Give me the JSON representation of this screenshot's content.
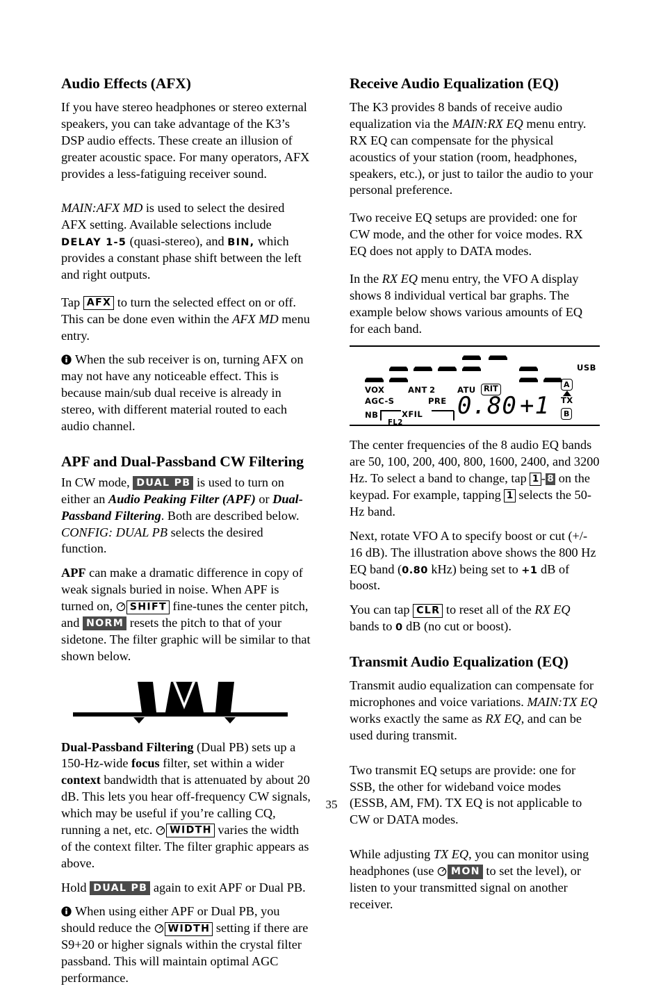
{
  "page": {
    "number": "35"
  },
  "left_column": {
    "afx": {
      "heading": "Audio Effects (AFX)",
      "p1": "If you have stereo headphones or stereo external speakers, you can take advantage of the K3’s DSP audio effects. These create an illusion of greater acoustic space. For many operators, AFX provides a less-fatiguing receiver sound.",
      "p2_a": "MAIN:AFX MD",
      "p2_b": " is used to select the desired AFX setting. Available selections include ",
      "p2_key1": "DELAY 1-5",
      "p2_c": " (quasi-stereo), and ",
      "p2_key2": "BIN,",
      "p2_d": " which provides a constant phase shift between the left and right outputs.",
      "p3_a": "Tap ",
      "p3_key": "AFX",
      "p3_b": " to turn the selected effect on or off. This can be done even within the ",
      "p3_italic": "AFX MD",
      "p3_c": " menu entry.",
      "note": "When the sub receiver is on, turning AFX on may not have any noticeable effect. This is because main/sub dual receive is already in stereo, with different material routed to each audio channel."
    },
    "apf": {
      "heading": "APF and Dual-Passband CW Filtering",
      "p1_a": "In CW mode, ",
      "p1_key": "DUAL PB",
      "p1_b": " is used to turn on either an ",
      "p1_bi1": "Audio Peaking Filter (APF)",
      "p1_c": " or ",
      "p1_bi2": "Dual-Passband Filtering",
      "p1_d": ". Both are described below. ",
      "p1_italic": "CONFIG: DUAL PB",
      "p1_e": " selects the desired function.",
      "p2_bold": "APF",
      "p2_a": " can make a dramatic difference in copy of weak signals buried in noise. When APF is turned on, ",
      "p2_key1": "SHIFT",
      "p2_b": " fine-tunes the center pitch, and ",
      "p2_key2": "NORM",
      "p2_c": " resets the pitch to that of your sidetone. The filter graphic will be similar to that shown below.",
      "p3_bold": "Dual-Passband Filtering",
      "p3_a": " (Dual PB) sets up a 150-Hz-wide ",
      "p3_b1": "focus",
      "p3_b": " filter, set within a wider ",
      "p3_b2": "context",
      "p3_c": " bandwidth that is attenuated by about 20 dB. This lets you hear off-frequency CW signals, which may be useful if you’re calling CQ, running a net, etc. ",
      "p3_key": "WIDTH",
      "p3_d": " varies the width of the context filter. The filter graphic appears as above.",
      "p4_a": "Hold ",
      "p4_key": "DUAL PB",
      "p4_b": " again to exit APF or Dual PB.",
      "note_a": "When using either APF or Dual PB, you should reduce the ",
      "note_key": "WIDTH",
      "note_b": " setting if there are S9+20 or higher signals within the crystal filter passband. This will maintain optimal AGC performance."
    }
  },
  "right_column": {
    "rx_eq": {
      "heading": "Receive Audio Equalization (EQ)",
      "p1_a": "The K3 provides 8 bands of receive audio equalization via the ",
      "p1_italic": "MAIN:RX EQ",
      "p1_b": " menu entry. RX EQ can compensate for the physical acoustics of your station (room, headphones, speakers, etc.), or just to tailor the audio to your personal preference.",
      "p2": "Two receive EQ setups are provided: one for CW mode, and the other for voice modes. RX EQ does not apply to DATA modes.",
      "p3_a": "In the ",
      "p3_italic": "RX EQ",
      "p3_b": " menu entry, the VFO A display shows 8 individual vertical bar graphs. The example below shows various amounts of EQ for each band.",
      "p4_a": "The center frequencies of the 8 audio EQ bands are 50, 100, 200, 400, 800, 1600, 2400, and 3200 Hz. To select a band to change, tap ",
      "p4_key1": "1",
      "p4_dash": "-",
      "p4_key2": "8",
      "p4_b": " on the keypad. For example, tapping ",
      "p4_key3": "1",
      "p4_c": " selects the 50-Hz band.",
      "p5_a": "Next, rotate VFO A to specify boost or cut (+/- 16 dB). The illustration above shows the 800 Hz EQ band (",
      "p5_mono1": "0.80",
      "p5_b": " kHz) being set to ",
      "p5_mono2": "+1",
      "p5_c": " dB of boost.",
      "p6_a": "You can tap ",
      "p6_key": "CLR",
      "p6_b": " to reset all of the ",
      "p6_italic": "RX EQ",
      "p6_c": " bands to ",
      "p6_mono": "0",
      "p6_d": " dB (no cut or boost)."
    },
    "tx_eq": {
      "heading": "Transmit Audio Equalization (EQ)",
      "p1_a": "Transmit audio equalization can compensate for microphones and voice variations. ",
      "p1_italic1": "MAIN:TX EQ",
      "p1_b": " works exactly the same as ",
      "p1_italic2": "RX EQ",
      "p1_c": ", and can be used during transmit.",
      "p2": "Two transmit EQ setups are provide: one for SSB, the other for wideband voice modes (ESSB, AM, FM). TX EQ is not applicable to CW or DATA modes.",
      "p3_a": "While adjusting ",
      "p3_italic": "TX EQ",
      "p3_b": ", you can monitor using headphones (use ",
      "p3_key": "MON",
      "p3_c": " to set the level), or listen to your transmitted signal on another receiver."
    }
  },
  "lcd_display": {
    "annunciators": {
      "vox": "VOX",
      "agc_s": "AGC-S",
      "nb": "NB",
      "ant": "ANT",
      "ant_num": "2",
      "pre": "PRE",
      "atu": "ATU",
      "rit": "RIT",
      "xfil": "XFIL",
      "fl2": "FL2",
      "usb": "USB",
      "vfo_a": "A",
      "tx": "TX",
      "vfo_b": "B"
    },
    "vfo_a_value": "0.80",
    "vfo_b_value": "+1",
    "eq_bargraph": {
      "bands_hz": [
        50,
        100,
        200,
        400,
        800,
        1600,
        2400,
        3200
      ],
      "segment_rows": [
        [
          3
        ],
        [
          2,
          3
        ],
        [
          2
        ],
        [
          2
        ],
        [
          1,
          2
        ],
        [
          1
        ],
        [
          2,
          3
        ],
        [
          3
        ]
      ],
      "row_count": 3
    }
  }
}
